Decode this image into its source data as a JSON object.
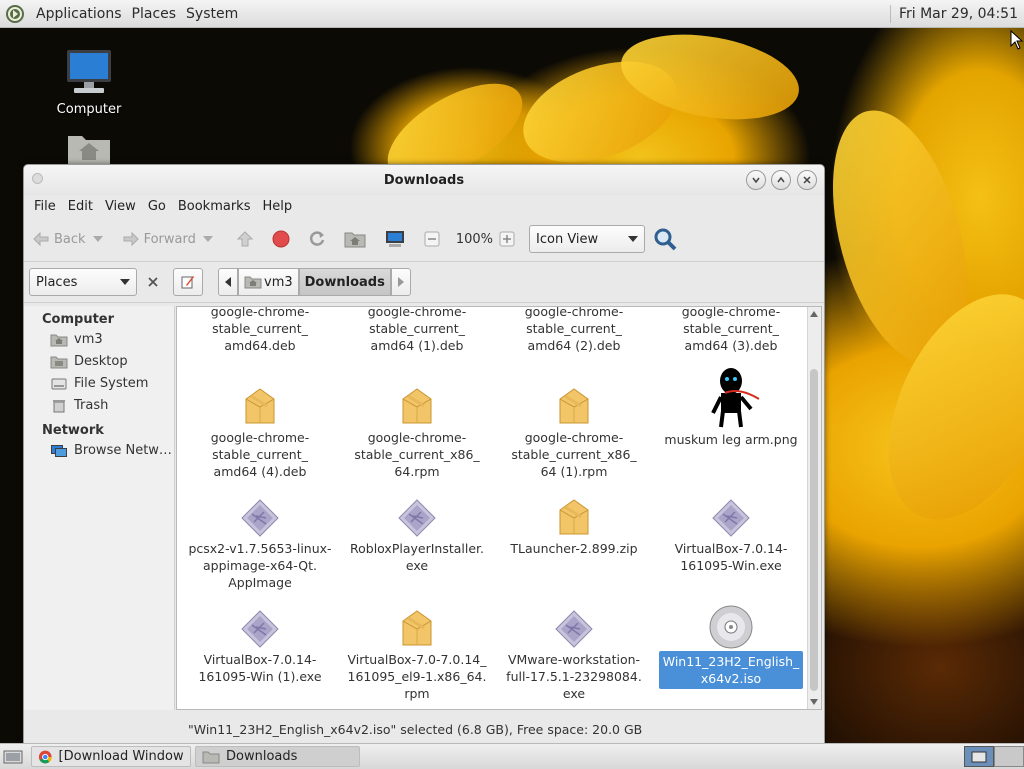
{
  "top_panel": {
    "menus": [
      "Applications",
      "Places",
      "System"
    ],
    "clock": "Fri Mar 29, 04:51"
  },
  "desktop": {
    "icons": [
      {
        "label": "Computer"
      }
    ]
  },
  "window": {
    "title": "Downloads",
    "menu": [
      "File",
      "Edit",
      "View",
      "Go",
      "Bookmarks",
      "Help"
    ],
    "toolbar": {
      "back": "Back",
      "forward": "Forward",
      "zoom": "100%",
      "view_mode": "Icon View"
    },
    "location": {
      "pane": "Places",
      "crumbs": [
        "vm3",
        "Downloads"
      ]
    },
    "sidebar": {
      "computer_heading": "Computer",
      "computer_items": [
        "vm3",
        "Desktop",
        "File System",
        "Trash"
      ],
      "network_heading": "Network",
      "network_items": [
        "Browse Netw…"
      ]
    },
    "files": [
      {
        "name": "google-chrome-stable_current_amd64.deb",
        "l1": "google-chrome-",
        "l2": "stable_current_",
        "l3": "amd64.deb",
        "icon": "package"
      },
      {
        "name": "google-chrome-stable_current_amd64 (1).deb",
        "l1": "google-chrome-",
        "l2": "stable_current_",
        "l3": "amd64 (1).deb",
        "icon": "package"
      },
      {
        "name": "google-chrome-stable_current_amd64 (2).deb",
        "l1": "google-chrome-",
        "l2": "stable_current_",
        "l3": "amd64 (2).deb",
        "icon": "package"
      },
      {
        "name": "google-chrome-stable_current_amd64 (3).deb",
        "l1": "google-chrome-",
        "l2": "stable_current_",
        "l3": "amd64 (3).deb",
        "icon": "package"
      },
      {
        "name": "google-chrome-stable_current_amd64 (4).deb",
        "l1": "google-chrome-",
        "l2": "stable_current_",
        "l3": "amd64 (4).deb",
        "icon": "package"
      },
      {
        "name": "google-chrome-stable_current_x86_64.rpm",
        "l1": "google-chrome-",
        "l2": "stable_current_x86_",
        "l3": "64.rpm",
        "icon": "package"
      },
      {
        "name": "google-chrome-stable_current_x86_64 (1).rpm",
        "l1": "google-chrome-",
        "l2": "stable_current_x86_",
        "l3": "64 (1).rpm",
        "icon": "package"
      },
      {
        "name": "muskum leg arm.png",
        "l1": "muskum leg arm.png",
        "l2": "",
        "l3": "",
        "icon": "image"
      },
      {
        "name": "pcsx2-v1.7.5653-linux-appimage-x64-Qt.AppImage",
        "l1": "pcsx2-v1.7.5653-linux-",
        "l2": "appimage-x64-Qt.",
        "l3": "AppImage",
        "icon": "executable"
      },
      {
        "name": "RobloxPlayerInstaller.exe",
        "l1": "RobloxPlayerInstaller.",
        "l2": "exe",
        "l3": "",
        "icon": "executable"
      },
      {
        "name": "TLauncher-2.899.zip",
        "l1": "TLauncher-2.899.zip",
        "l2": "",
        "l3": "",
        "icon": "package"
      },
      {
        "name": "VirtualBox-7.0.14-161095-Win.exe",
        "l1": "VirtualBox-7.0.14-",
        "l2": "161095-Win.exe",
        "l3": "",
        "icon": "executable"
      },
      {
        "name": "VirtualBox-7.0.14-161095-Win (1).exe",
        "l1": "VirtualBox-7.0.14-",
        "l2": "161095-Win (1).exe",
        "l3": "",
        "icon": "executable"
      },
      {
        "name": "VirtualBox-7.0-7.0.14_161095_el9-1.x86_64.rpm",
        "l1": "VirtualBox-7.0-7.0.14_",
        "l2": "161095_el9-1.x86_64.",
        "l3": "rpm",
        "icon": "package"
      },
      {
        "name": "VMware-workstation-full-17.5.1-23298084.exe",
        "l1": "VMware-workstation-",
        "l2": "full-17.5.1-23298084.",
        "l3": "exe",
        "icon": "executable"
      },
      {
        "name": "Win11_23H2_English_x64v2.iso",
        "l1": "Win11_23H2_English_",
        "l2": "x64v2.iso",
        "l3": "",
        "icon": "disc",
        "selected": true
      }
    ],
    "status": "\"Win11_23H2_English_x64v2.iso\" selected (6.8 GB), Free space: 20.0 GB"
  },
  "bottom_panel": {
    "tasks": [
      "[Download Window…",
      "Downloads"
    ]
  },
  "colors": {
    "selection": "#4a90d9"
  }
}
